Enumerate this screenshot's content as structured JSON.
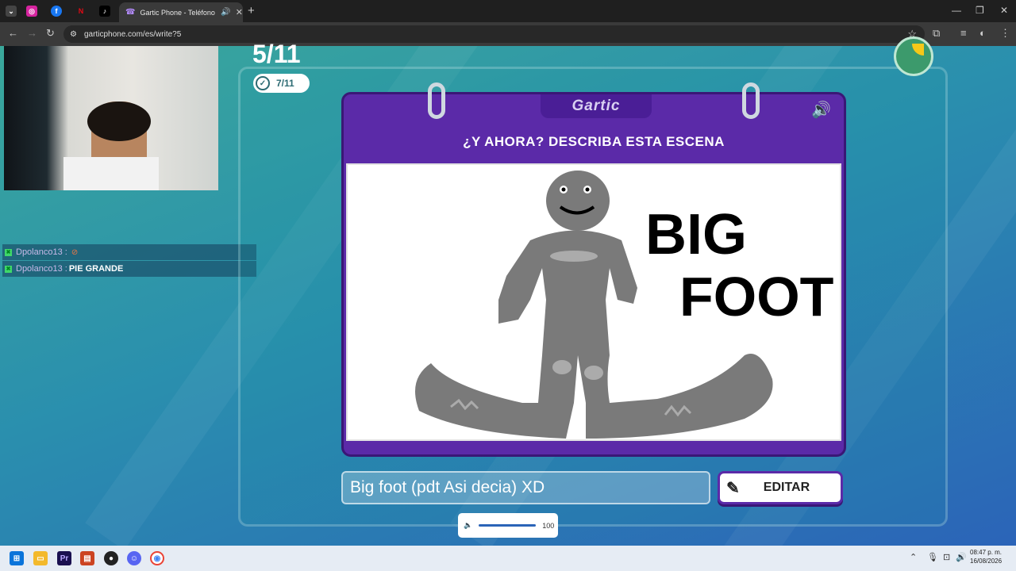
{
  "browser": {
    "active_tab_title": "Gartic Phone - Teléfono De...",
    "url": "garticphone.com/es/write?5"
  },
  "chat": [
    {
      "user": "Dpolanco13 :",
      "message": "",
      "icon": "no-entry-emoji-icon"
    },
    {
      "user": "Dpolanco13 :",
      "message": "PIE GRANDE"
    }
  ],
  "game": {
    "round": "5/11",
    "done": "7/11",
    "logo": "Gartic",
    "prompt": "¿Y AHORA? DESCRIBA ESTA ESCENA",
    "drawing_text": [
      "BIG",
      "FOOT"
    ],
    "answer_value": "Big foot (pdt Asi decia) XD",
    "edit_label": "EDITAR",
    "volume": "100",
    "timer_fraction_elapsed": 0.2
  },
  "taskbar": {
    "time": "08:47 p. m.",
    "date": "16/08/2026"
  },
  "colors": {
    "book": "#5b2aa8",
    "timer": "#3c9a6c",
    "accent": "#f6c818"
  }
}
